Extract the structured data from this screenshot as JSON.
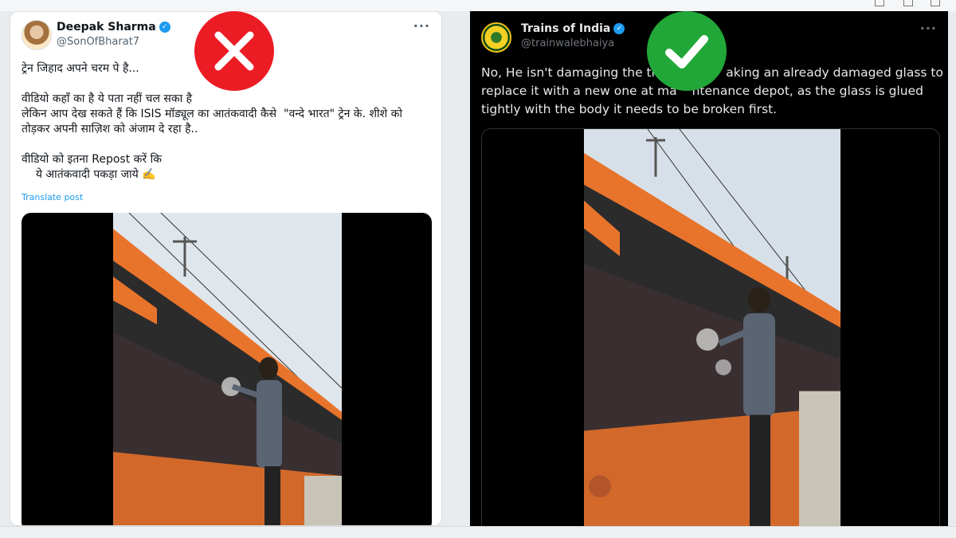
{
  "left_post": {
    "display_name": "Deepak Sharma",
    "handle": "@SonOfBharat7",
    "more_label": "···",
    "text_lines": [
      "ट्रेन जिहाद अपने चरम पे है...",
      "",
      "वीडियो कहाँ का है ये पता नहीं चल सका है",
      "लेकिन आप देख सकते हैं कि ISIS मॉड्यूल का आतंकवादी कैसे  \"वन्दे भारत\" ट्रेन के. शीशे को",
      "तोड़कर अपनी साज़िश को अंजाम दे रहा है..",
      "",
      "वीडियो को इतना Repost करें कि",
      "    ये आतंकवादी पकड़ा जाये ✍️"
    ],
    "translate_label": "Translate post",
    "verdict_icon": "cross-mark-icon"
  },
  "right_post": {
    "display_name": "Trains of India",
    "handle": "@trainwalebhaiya",
    "more_label": "···",
    "text_lines": [
      "No, He isn't damaging the tr",
      "replace it with a new one at ma",
      "tightly with the body it needs to be broken first."
    ],
    "text_after_stamp": [
      "aking an already damaged glass to",
      "ntenance depot, as the glass is glued"
    ],
    "verdict_icon": "check-mark-icon"
  },
  "colors": {
    "wrong_red": "#ec1c24",
    "correct_green": "#21a737",
    "verified_blue": "#1d9bf0",
    "train_orange": "#e8742c"
  }
}
